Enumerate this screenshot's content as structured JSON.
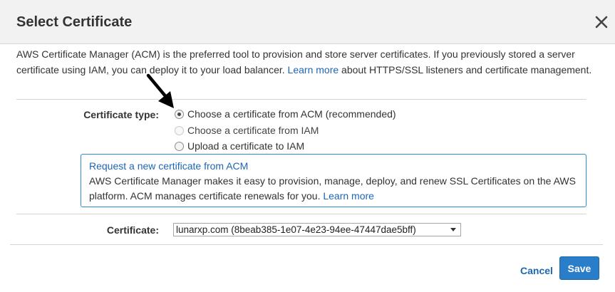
{
  "dialog": {
    "title": "Select Certificate"
  },
  "intro": {
    "text_1": "AWS Certificate Manager (ACM) is the preferred tool to provision and store server certificates. If you previously stored a server certificate using IAM, you can deploy it to your load balancer.",
    "link": "Learn more",
    "text_2": "about HTTPS/SSL listeners and certificate management."
  },
  "certificate_type": {
    "label": "Certificate type:",
    "options": [
      {
        "label": "Choose a certificate from ACM (recommended)",
        "state": "checked"
      },
      {
        "label": "Choose a certificate from IAM",
        "state": "disabled"
      },
      {
        "label": "Upload a certificate to IAM",
        "state": "unchecked"
      }
    ]
  },
  "info_box": {
    "link_title": "Request a new certificate from ACM",
    "text": "AWS Certificate Manager makes it easy to provision, manage, deploy, and renew SSL Certificates on the AWS platform. ACM manages certificate renewals for you.",
    "learn_more": "Learn more"
  },
  "certificate": {
    "label": "Certificate:",
    "selected": "lunarxp.com (8beab385-1e07-4e23-94ee-47447dae5bff)"
  },
  "footer": {
    "cancel_label": "Cancel",
    "save_label": "Save"
  },
  "colors": {
    "link": "#1e66b4",
    "primary_button": "#2a7ec9",
    "info_border": "#2c8ec8",
    "header_bg": "#f2f2f2"
  }
}
